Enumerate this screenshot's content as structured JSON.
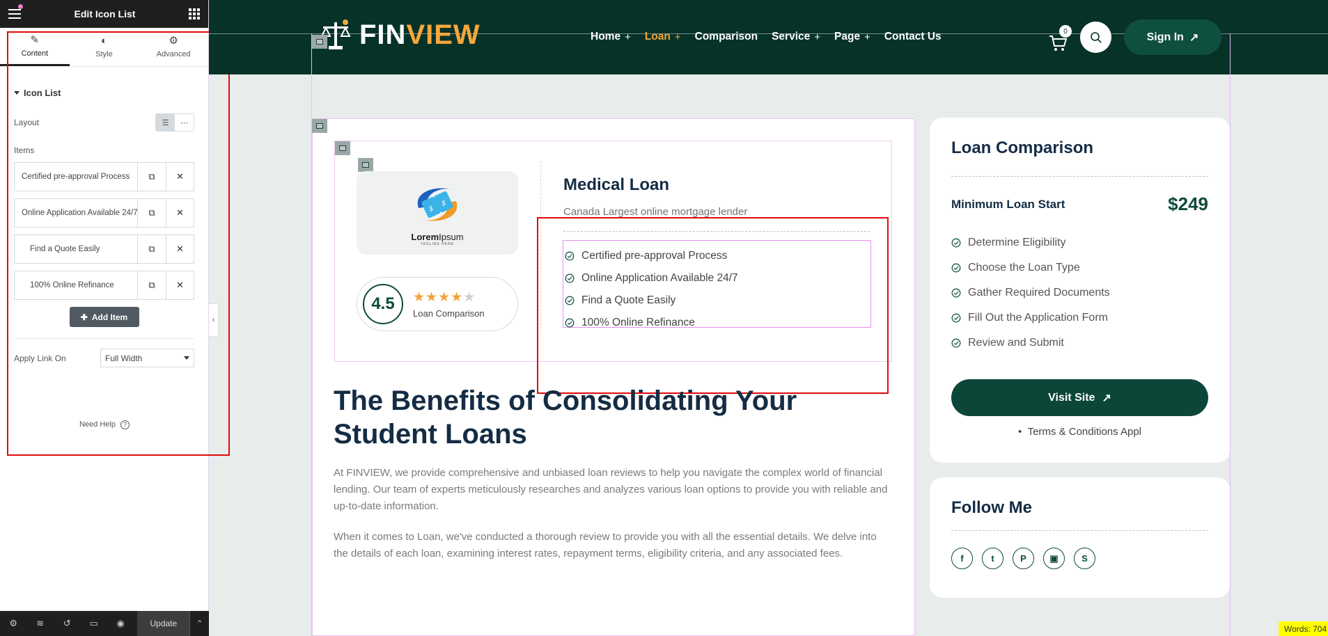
{
  "editor": {
    "title": "Edit Icon List",
    "tabs": [
      {
        "label": "Content",
        "icon": "pencil-icon"
      },
      {
        "label": "Style",
        "icon": "contrast-icon"
      },
      {
        "label": "Advanced",
        "icon": "gear-icon"
      }
    ],
    "section_title": "Icon List",
    "layout_label": "Layout",
    "items_label": "Items",
    "items": [
      {
        "label": "Certified pre-approval Process"
      },
      {
        "label": "Online Application Available 24/7"
      },
      {
        "label": "Find a Quote Easily"
      },
      {
        "label": "100% Online Refinance"
      }
    ],
    "add_item_label": "Add Item",
    "apply_link_label": "Apply Link On",
    "apply_link_value": "Full Width",
    "need_help_label": "Need Help",
    "update_label": "Update"
  },
  "site": {
    "logo": {
      "part1": "FIN",
      "part2": "VIEW"
    },
    "nav": [
      {
        "label": "Home",
        "has_plus": true
      },
      {
        "label": "Loan",
        "has_plus": true,
        "active": true
      },
      {
        "label": "Comparison",
        "has_plus": false
      },
      {
        "label": "Service",
        "has_plus": true
      },
      {
        "label": "Page",
        "has_plus": true
      },
      {
        "label": "Contact Us",
        "has_plus": false
      }
    ],
    "cart_count": "0",
    "signin_label": "Sign In",
    "card": {
      "logo_brand": "Lorem",
      "logo_brand2": "Ipsum",
      "logo_tagline": "TAGLINE HERE",
      "rating": "4.5",
      "stars": "★★★★",
      "half_star": "★",
      "rating_label": "Loan Comparison",
      "loan_title": "Medical Loan",
      "loan_subtitle": "Canada Largest online mortgage lender",
      "features": [
        "Certified pre-approval Process",
        "Online Application Available 24/7",
        "Find a Quote Easily",
        "100% Online Refinance"
      ]
    },
    "article": {
      "heading": "The Benefits of Consolidating Your Student Loans",
      "para1": "At FINVIEW, we provide comprehensive and unbiased loan reviews to help you navigate the complex world of financial lending. Our team of experts meticulously researches and analyzes various loan options to provide you with reliable and up-to-date information.",
      "para2": "When it comes to Loan, we've conducted a thorough review to provide you with all the essential details. We delve into the details of each loan, examining interest rates, repayment terms, eligibility criteria, and any associated fees."
    },
    "sidebar": {
      "comparison_title": "Loan Comparison",
      "min_label": "Minimum Loan Start",
      "min_value": "$249",
      "steps": [
        "Determine Eligibility",
        "Choose the Loan Type",
        "Gather Required Documents",
        "Fill Out the Application Form",
        "Review and Submit"
      ],
      "visit_label": "Visit Site",
      "terms_label": "Terms & Conditions Appl",
      "follow_title": "Follow Me",
      "socials": [
        {
          "icon": "facebook-icon",
          "glyph": "f"
        },
        {
          "icon": "twitter-icon",
          "glyph": "t"
        },
        {
          "icon": "pinterest-icon",
          "glyph": "P"
        },
        {
          "icon": "twitch-icon",
          "glyph": "▣"
        },
        {
          "icon": "skype-icon",
          "glyph": "S"
        }
      ]
    },
    "word_count": "Words: 704"
  },
  "colors": {
    "header_bg": "#063228",
    "accent": "#f6a73c",
    "primary_green": "#0c4638",
    "selection_red": "#e10b0b"
  }
}
